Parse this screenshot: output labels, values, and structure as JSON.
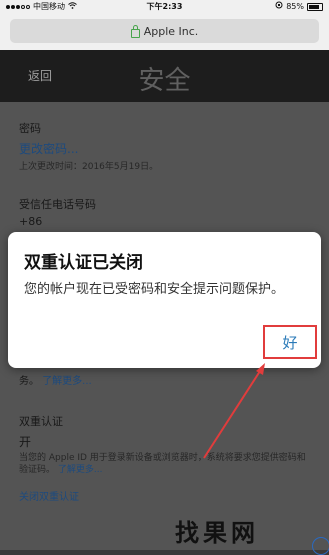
{
  "status_bar": {
    "carrier": "中国移动",
    "time": "下午2:33",
    "battery": "85%"
  },
  "url_bar": {
    "text": "Apple Inc."
  },
  "nav": {
    "back": "返回",
    "title": "安全"
  },
  "password_section": {
    "heading": "密码",
    "change_link": "更改密码...",
    "last_changed": "上次更改时间：2016年5月19日。"
  },
  "trusted_phone": {
    "heading": "受信任电话号码",
    "number": "+86"
  },
  "learn_more_line": {
    "prefix": "务。",
    "link": "了解更多..."
  },
  "two_factor": {
    "heading": "双重认证",
    "state": "开",
    "description": "当您的 Apple ID 用于登录新设备或浏览器时，系统将要求您提供密码和验证码。",
    "learn_more": "了解更多...",
    "turn_off_link": "关闭双重认证"
  },
  "dialog": {
    "title": "双重认证已关闭",
    "message": "您的帐户现在已受密码和安全提示问题保护。",
    "ok": "好"
  },
  "watermark": {
    "text": "找果网"
  },
  "colors": {
    "link": "#1f4f86",
    "annotation": "#e13c3c",
    "dialog_button": "#2a7ab8"
  }
}
